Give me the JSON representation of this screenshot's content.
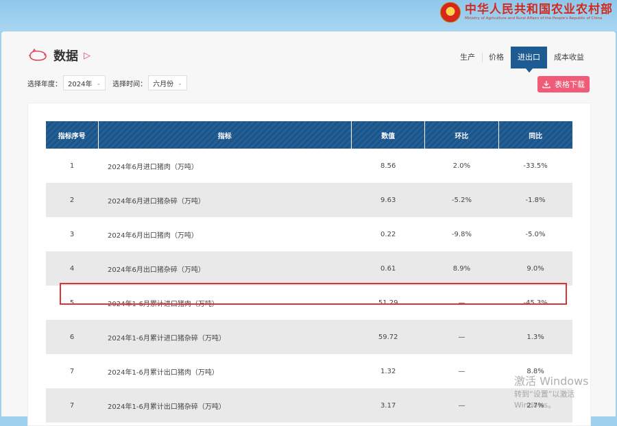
{
  "header": {
    "ministry_cn": "中华人民共和国农业农村部",
    "ministry_en": "Ministry of Agriculture and Rural Affairs of the People's Republic of China"
  },
  "page": {
    "title": "数据"
  },
  "tabs": [
    {
      "label": "生产",
      "active": false
    },
    {
      "label": "价格",
      "active": false
    },
    {
      "label": "进出口",
      "active": true
    },
    {
      "label": "成本收益",
      "active": false
    }
  ],
  "filters": {
    "year_label": "选择年度：",
    "year_value": "2024年",
    "time_label": "选择时间：",
    "time_value": "六月份"
  },
  "download_label": "表格下载",
  "table": {
    "headers": [
      "指标序号",
      "指标",
      "数值",
      "环比",
      "同比"
    ],
    "rows": [
      {
        "no": "1",
        "name": "2024年6月进口猪肉（万吨）",
        "value": "8.56",
        "mom": "2.0%",
        "yoy": "-33.5%"
      },
      {
        "no": "2",
        "name": "2024年6月进口猪杂碎（万吨）",
        "value": "9.63",
        "mom": "-5.2%",
        "yoy": "-1.8%"
      },
      {
        "no": "3",
        "name": "2024年6月出口猪肉（万吨）",
        "value": "0.22",
        "mom": "-9.8%",
        "yoy": "-5.0%"
      },
      {
        "no": "4",
        "name": "2024年6月出口猪杂碎（万吨）",
        "value": "0.61",
        "mom": "8.9%",
        "yoy": "9.0%"
      },
      {
        "no": "5",
        "name": "2024年1-6月累计进口猪肉（万吨）",
        "value": "51.29",
        "mom": "—",
        "yoy": "-45.3%"
      },
      {
        "no": "6",
        "name": "2024年1-6月累计进口猪杂碎（万吨）",
        "value": "59.72",
        "mom": "—",
        "yoy": "1.3%"
      },
      {
        "no": "7",
        "name": "2024年1-6月累计出口猪肉（万吨）",
        "value": "1.32",
        "mom": "—",
        "yoy": "8.8%"
      },
      {
        "no": "7",
        "name": "2024年1-6月累计出口猪杂碎（万吨）",
        "value": "3.17",
        "mom": "—",
        "yoy": "2.7%"
      }
    ]
  },
  "watermark": {
    "line1": "激活 Windows",
    "line2": "转到“设置”以激活 Windows。"
  }
}
